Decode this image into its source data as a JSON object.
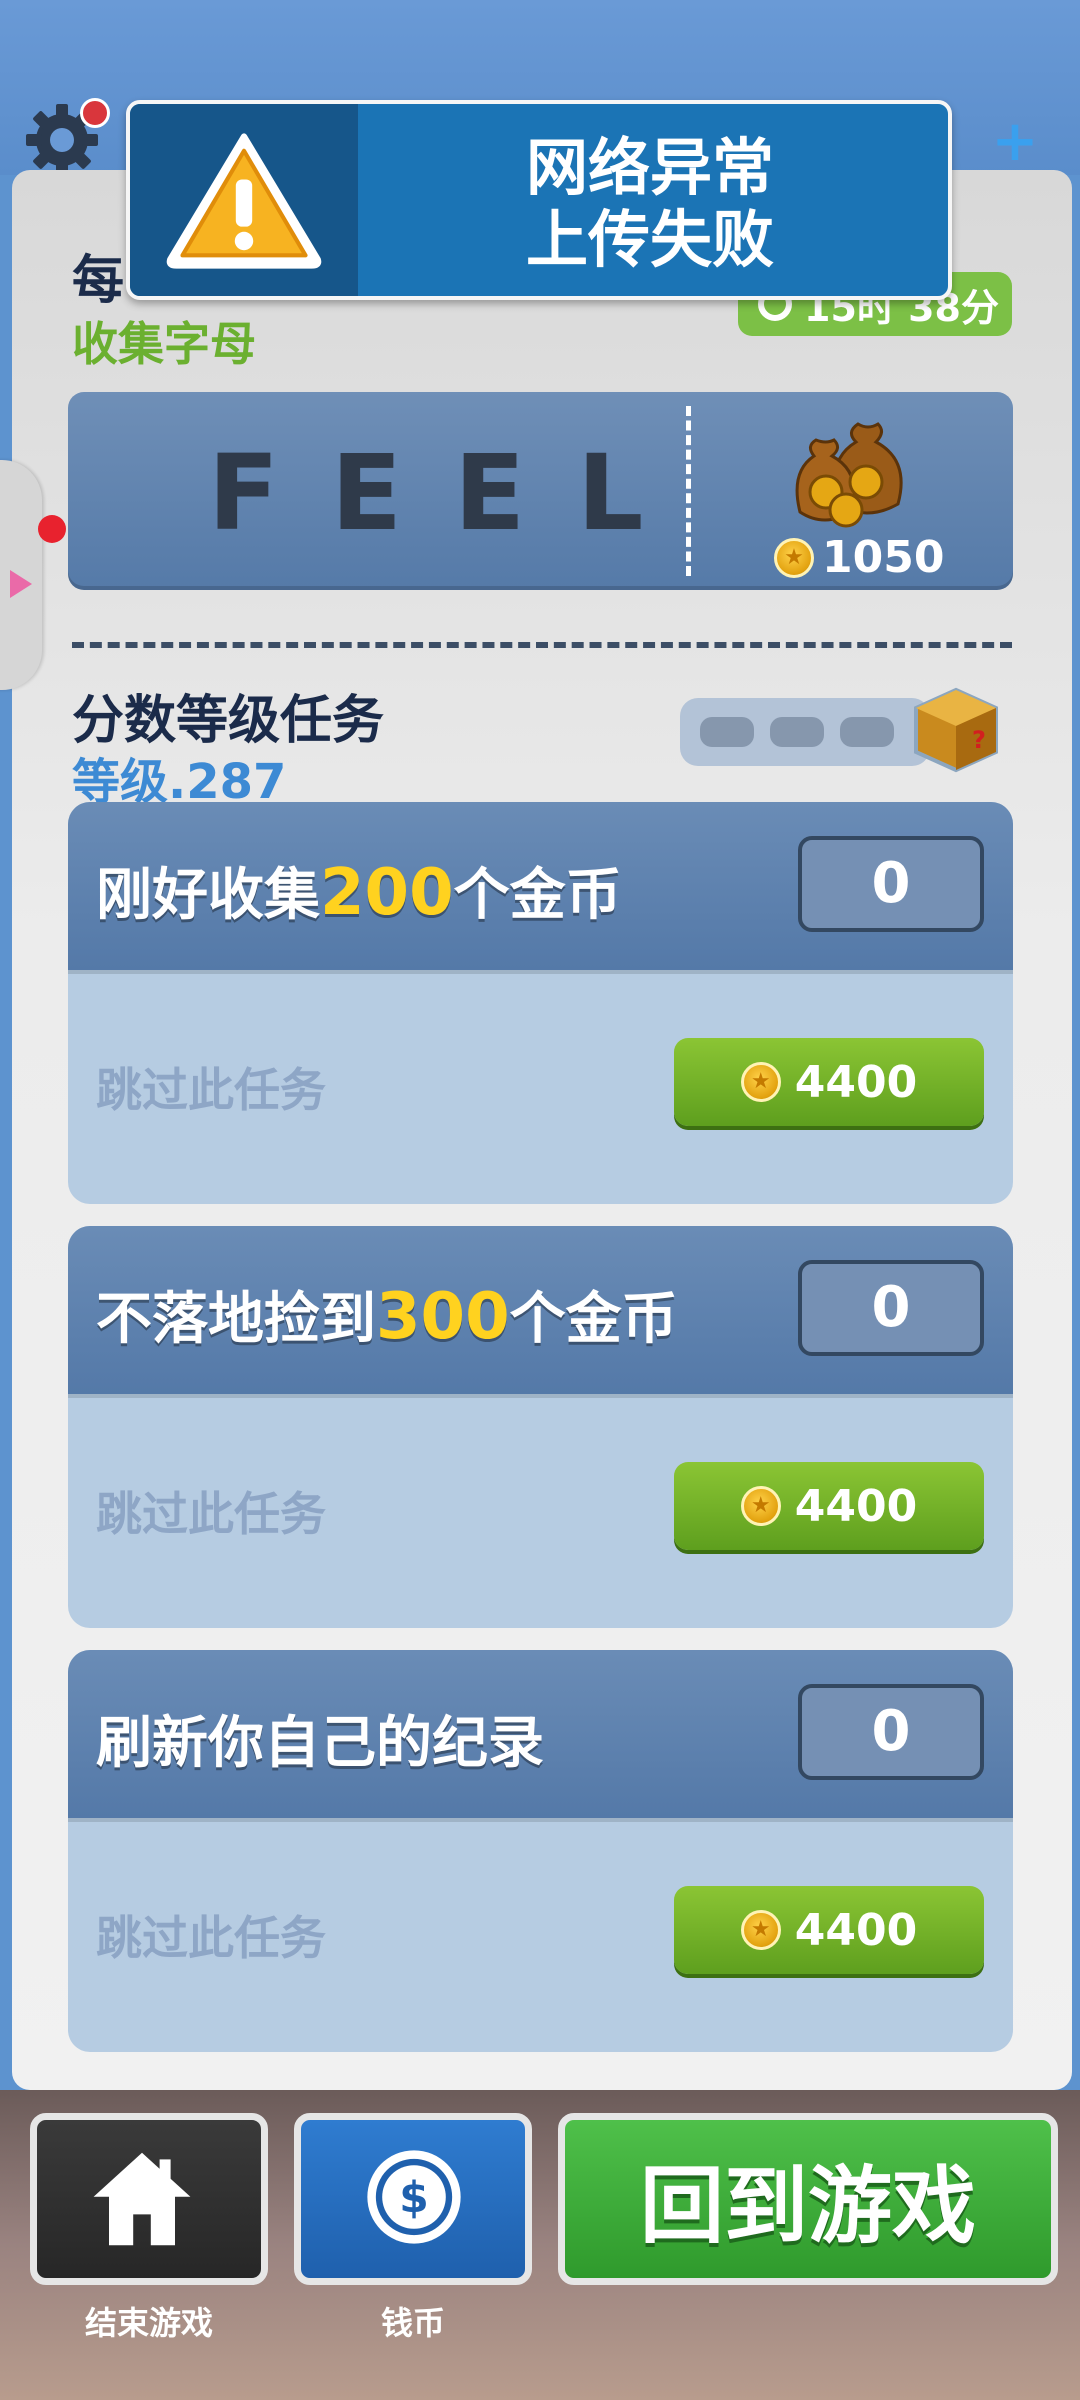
{
  "alert": {
    "line1": "网络异常",
    "line2": "上传失败",
    "icon": "warning-icon"
  },
  "header": {
    "settings_icon": "gear-icon",
    "add_icon": "plus-icon"
  },
  "daily": {
    "title": "每",
    "subtitle": "收集字母",
    "timer": "15时 38分",
    "letters": "FEEL",
    "reward": "1050"
  },
  "score_tasks": {
    "title": "分数等级任务",
    "level": "等级.287",
    "progress_slots": 3,
    "tasks": [
      {
        "pre": "刚好收集",
        "num": "200",
        "post": "个金币",
        "count": "0",
        "skip_label": "跳过此任务",
        "skip_cost": "4400"
      },
      {
        "pre": "不落地捡到",
        "num": "300",
        "post": "个金币",
        "count": "0",
        "skip_label": "跳过此任务",
        "skip_cost": "4400"
      },
      {
        "pre": "刷新你自己的纪录",
        "num": "",
        "post": "",
        "count": "0",
        "skip_label": "跳过此任务",
        "skip_cost": "4400"
      }
    ]
  },
  "bottom": {
    "home_label": "结束游戏",
    "coins_label": "钱币",
    "play_label": "回到游戏"
  }
}
